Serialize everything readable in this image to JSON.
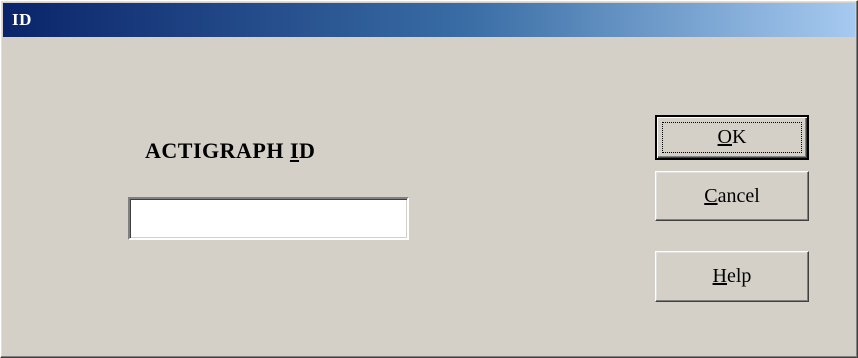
{
  "window": {
    "title": "ID"
  },
  "form": {
    "label_prefix": "ACTIGRAPH ",
    "label_mnemonic": "I",
    "label_suffix": "D",
    "input_value": ""
  },
  "buttons": {
    "ok": {
      "mnemonic": "O",
      "rest": "K"
    },
    "cancel": {
      "mnemonic": "C",
      "rest": "ancel"
    },
    "help": {
      "mnemonic": "H",
      "rest": "elp"
    }
  },
  "colors": {
    "dialog_face": "#d4d0c8",
    "titlebar_start": "#0a246a",
    "titlebar_end": "#a6caf0"
  }
}
